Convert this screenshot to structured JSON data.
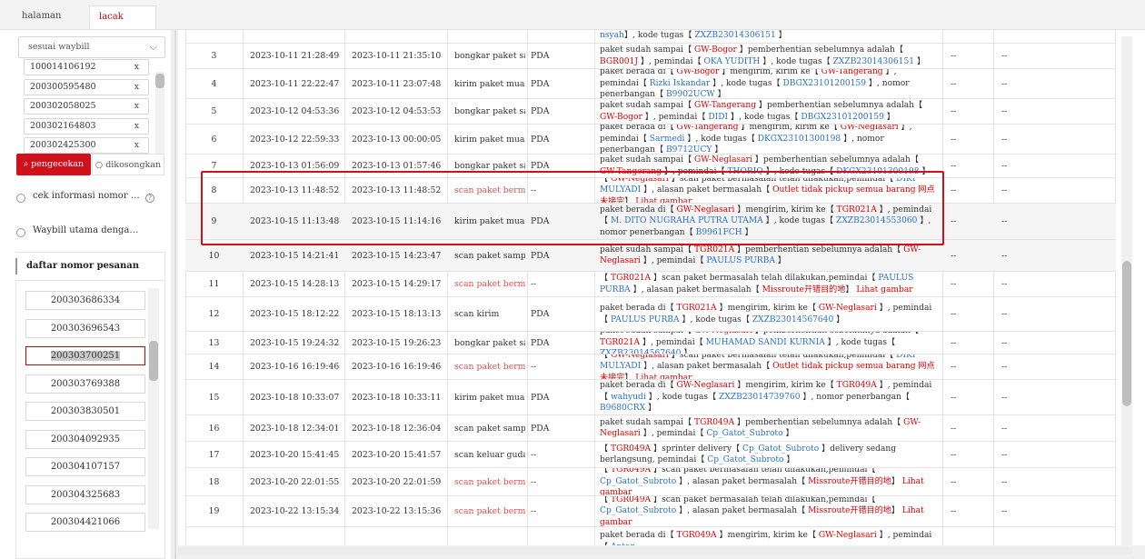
{
  "tabs": [
    {
      "label": "halaman utama",
      "active": false
    },
    {
      "label": "lacak paket",
      "active": true,
      "close": "×"
    }
  ],
  "filter": {
    "select_value": "sesuai waybill",
    "chevron": "chevron-down-icon"
  },
  "waybills": [
    "100014106192",
    "200300595480",
    "200302058025",
    "200302164803",
    "200302425300"
  ],
  "waybill_remove": "x",
  "buttons": {
    "search": "pengecekan",
    "clear": "dikosongkan",
    "search_icon": "search-icon",
    "clear_icon": "circle-icon"
  },
  "options": [
    {
      "label": "cek informasi nomor …",
      "help": "?"
    },
    {
      "label": "Waybill utama denga…"
    }
  ],
  "order_list": {
    "title": "daftar nomor pesanan",
    "items": [
      "200303686334",
      "200303696543",
      "200303700251",
      "200303769388",
      "200303830501",
      "200304092935",
      "200304107157",
      "200304325683",
      "200304421066"
    ],
    "selected_index": 2
  },
  "rows": [
    {
      "no": "",
      "t1": "",
      "t2": "",
      "type": "",
      "type_red": false,
      "src": "",
      "desc": [
        [
          "lk",
          "nsyah"
        ],
        [
          "t",
          "】, kode tugas【 "
        ],
        [
          "lk",
          "ZXZB23014306151"
        ],
        [
          "t",
          " 】"
        ]
      ],
      "a": "",
      "b": ""
    },
    {
      "no": "3",
      "t1": "2023-10-11 21:28:49",
      "t2": "2023-10-11 21:35:10",
      "type": "bongkar paket sampai",
      "type_red": false,
      "src": "PDA",
      "desc": [
        [
          "t",
          "paket sudah sampai【 "
        ],
        [
          "rd",
          "GW-Bogor"
        ],
        [
          "t",
          " 】pemberhentian sebelumnya adalah【 "
        ],
        [
          "rd",
          "BGR001J"
        ],
        [
          "t",
          " 】, pemindai【 "
        ],
        [
          "lk",
          "OKA YUDITH"
        ],
        [
          "t",
          " 】, kode tugas【 "
        ],
        [
          "lk",
          "ZXZB23014306151"
        ],
        [
          "t",
          " 】"
        ]
      ],
      "a": "--",
      "b": "--"
    },
    {
      "no": "4",
      "t1": "2023-10-11 22:22:47",
      "t2": "2023-10-11 23:07:48",
      "type": "kirim paket muatan",
      "type_red": false,
      "src": "PDA",
      "desc": [
        [
          "t",
          "paket berada di【 "
        ],
        [
          "rd",
          "GW-Bogor"
        ],
        [
          "t",
          " 】mengirim, kirim ke【 "
        ],
        [
          "rd",
          "GW-Tangerang"
        ],
        [
          "t",
          " 】, pemindai【 "
        ],
        [
          "lk",
          "Rizki Iskandar"
        ],
        [
          "t",
          " 】, kode tugas【 "
        ],
        [
          "lk",
          "DBGX23101200159"
        ],
        [
          "t",
          " 】, nomor penerbangan【 "
        ],
        [
          "lk",
          "B9902UCW"
        ],
        [
          "t",
          " 】"
        ]
      ],
      "a": "--",
      "b": "--"
    },
    {
      "no": "5",
      "t1": "2023-10-12 04:53:36",
      "t2": "2023-10-12 04:53:53",
      "type": "bongkar paket sampai",
      "type_red": false,
      "src": "PDA",
      "desc": [
        [
          "t",
          "paket sudah sampai【 "
        ],
        [
          "rd",
          "GW-Tangerang"
        ],
        [
          "t",
          " 】pemberhentian sebelumnya adalah【 "
        ],
        [
          "rd",
          "GW-Bogor"
        ],
        [
          "t",
          " 】, pemindai【 "
        ],
        [
          "lk",
          "DIDI"
        ],
        [
          "t",
          " 】, kode tugas【 "
        ],
        [
          "lk",
          "DBGX23101200159"
        ],
        [
          "t",
          " 】"
        ]
      ],
      "a": "--",
      "b": "--"
    },
    {
      "no": "6",
      "t1": "2023-10-12 22:59:33",
      "t2": "2023-10-13 00:00:05",
      "type": "kirim paket muatan",
      "type_red": false,
      "src": "PDA",
      "desc": [
        [
          "t",
          "paket berada di【 "
        ],
        [
          "rd",
          "GW-Tangerang"
        ],
        [
          "t",
          " 】mengirim, kirim ke【 "
        ],
        [
          "rd",
          "GW-Neglasari"
        ],
        [
          "t",
          " 】, pemindai【 "
        ],
        [
          "lk",
          "Sarmedi"
        ],
        [
          "t",
          " 】, kode tugas【 "
        ],
        [
          "lk",
          "DKGX23101300198"
        ],
        [
          "t",
          " 】, nomor penerbangan【 "
        ],
        [
          "lk",
          "B9712UCY"
        ],
        [
          "t",
          " 】"
        ]
      ],
      "a": "--",
      "b": "--"
    },
    {
      "no": "7",
      "t1": "2023-10-13 01:56:09",
      "t2": "2023-10-13 01:57:46",
      "type": "bongkar paket sampai",
      "type_red": false,
      "src": "PDA",
      "desc": [
        [
          "t",
          "paket sudah sampai【 "
        ],
        [
          "rd",
          "GW-Neglasari"
        ],
        [
          "t",
          " 】pemberhentian sebelumnya adalah【 "
        ],
        [
          "rd",
          "GW-Tangerang"
        ],
        [
          "t",
          " 】, pemindai【 "
        ],
        [
          "lk",
          "THORIQ"
        ],
        [
          "t",
          " 】, kode tugas【 "
        ],
        [
          "lk",
          "DKGX23101300198"
        ],
        [
          "t",
          " 】"
        ]
      ],
      "a": "--",
      "b": "--"
    },
    {
      "no": "8",
      "t1": "2023-10-13 11:48:52",
      "t2": "2023-10-13 11:48:52",
      "type": "scan paket bermasalah",
      "type_red": true,
      "src": "--",
      "desc": [
        [
          "t",
          "【 "
        ],
        [
          "rd",
          "GW-Neglasari"
        ],
        [
          "t",
          " 】scan paket bermasalah telah dilakukan,pemindai【 "
        ],
        [
          "lk",
          "DIKI MULYADI"
        ],
        [
          "t",
          " 】, alasan paket bermasalah【 "
        ],
        [
          "rd",
          "Outlet tidak pickup semua barang 网点未接完"
        ],
        [
          "t",
          "】 "
        ],
        [
          "rd",
          "Lihat gambar"
        ]
      ],
      "a": "--",
      "b": "--"
    },
    {
      "no": "9",
      "t1": "2023-10-15 11:13:48",
      "t2": "2023-10-15 11:14:16",
      "type": "kirim paket muatan",
      "type_red": false,
      "src": "PDA",
      "desc": [
        [
          "t",
          "paket berada di【 "
        ],
        [
          "rd",
          "GW-Neglasari"
        ],
        [
          "t",
          " 】mengirim, kirim ke【 "
        ],
        [
          "rd",
          "TGR021A"
        ],
        [
          "t",
          " 】, pemindai【 "
        ],
        [
          "lk",
          "M. DITO NUGRAHA PUTRA UTAMA"
        ],
        [
          "t",
          " 】, kode tugas【 "
        ],
        [
          "lk",
          "ZXZB23014553060"
        ],
        [
          "t",
          " 】, nomor penerbangan【 "
        ],
        [
          "lk",
          "B9961FCH"
        ],
        [
          "t",
          " 】"
        ]
      ],
      "a": "--",
      "b": "--"
    },
    {
      "no": "10",
      "t1": "2023-10-15 14:21:41",
      "t2": "2023-10-15 14:23:47",
      "type": "scan paket sampai",
      "type_red": false,
      "src": "PDA",
      "desc": [
        [
          "t",
          "paket sudah sampai【 "
        ],
        [
          "rd",
          "TGR021A"
        ],
        [
          "t",
          " 】pemberhentian sebelumnya adalah【 "
        ],
        [
          "rd",
          "GW-Neglasari"
        ],
        [
          "t",
          " 】, pemindai【 "
        ],
        [
          "lk",
          "PAULUS PURBA"
        ],
        [
          "t",
          " 】"
        ]
      ],
      "a": "--",
      "b": "--"
    },
    {
      "no": "11",
      "t1": "2023-10-15 14:28:13",
      "t2": "2023-10-15 14:29:17",
      "type": "scan paket bermasalah",
      "type_red": true,
      "src": "--",
      "desc": [
        [
          "t",
          "【 "
        ],
        [
          "rd",
          "TGR021A"
        ],
        [
          "t",
          " 】scan paket bermasalah telah dilakukan,pemindai【 "
        ],
        [
          "lk",
          "PAULUS PURBA"
        ],
        [
          "t",
          " 】, alasan paket bermasalah【 "
        ],
        [
          "rd",
          "Missroute开错目的地"
        ],
        [
          "t",
          "】 "
        ],
        [
          "rd",
          "Lihat gambar"
        ]
      ],
      "a": "--",
      "b": "--"
    },
    {
      "no": "12",
      "t1": "2023-10-15 18:12:22",
      "t2": "2023-10-15 18:13:13",
      "type": "scan kirim",
      "type_red": false,
      "src": "PDA",
      "desc": [
        [
          "t",
          "paket berada di【 "
        ],
        [
          "rd",
          "TGR021A"
        ],
        [
          "t",
          " 】mengirim, kirim ke【 "
        ],
        [
          "rd",
          "GW-Neglasari"
        ],
        [
          "t",
          " 】, pemindai【 "
        ],
        [
          "lk",
          "PAULUS PURBA"
        ],
        [
          "t",
          " 】, kode tugas【 "
        ],
        [
          "lk",
          "ZXZB23014567640"
        ],
        [
          "t",
          " 】"
        ]
      ],
      "a": "--",
      "b": "--"
    },
    {
      "no": "13",
      "t1": "2023-10-15 19:24:32",
      "t2": "2023-10-15 19:26:23",
      "type": "bongkar paket sampai",
      "type_red": false,
      "src": "PDA",
      "desc": [
        [
          "t",
          "paket sudah sampai【 "
        ],
        [
          "rd",
          "GW-Neglasari"
        ],
        [
          "t",
          " 】pemberhentian sebelumnya adalah【 "
        ],
        [
          "rd",
          "TGR021A"
        ],
        [
          "t",
          " 】, pemindai【 "
        ],
        [
          "lk",
          "MUHAMAD SANDI KURNIA"
        ],
        [
          "t",
          " 】, kode tugas【 "
        ],
        [
          "lk",
          "ZXZB23014567640"
        ],
        [
          "t",
          " 】"
        ]
      ],
      "a": "--",
      "b": "--"
    },
    {
      "no": "14",
      "t1": "2023-10-16 16:19:46",
      "t2": "2023-10-16 16:19:46",
      "type": "scan paket bermasalah",
      "type_red": true,
      "src": "--",
      "desc": [
        [
          "t",
          "【 "
        ],
        [
          "rd",
          "GW-Neglasari"
        ],
        [
          "t",
          " 】scan paket bermasalah telah dilakukan,pemindai【 "
        ],
        [
          "lk",
          "DIKI MULYADI"
        ],
        [
          "t",
          " 】, alasan paket bermasalah【 "
        ],
        [
          "rd",
          "Outlet tidak pickup semua barang 网点未接完"
        ],
        [
          "t",
          "】 "
        ],
        [
          "rd",
          "Lihat gambar"
        ]
      ],
      "a": "--",
      "b": "--"
    },
    {
      "no": "15",
      "t1": "2023-10-18 10:33:07",
      "t2": "2023-10-18 10:33:11",
      "type": "kirim paket muatan",
      "type_red": false,
      "src": "PDA",
      "desc": [
        [
          "t",
          "paket berada di【 "
        ],
        [
          "rd",
          "GW-Neglasari"
        ],
        [
          "t",
          " 】mengirim, kirim ke【 "
        ],
        [
          "rd",
          "TGR049A"
        ],
        [
          "t",
          " 】, pemindai【 "
        ],
        [
          "lk",
          "wahyudi"
        ],
        [
          "t",
          " 】, kode tugas【 "
        ],
        [
          "lk",
          "ZXZB23014739760"
        ],
        [
          "t",
          " 】, nomor penerbangan【 "
        ],
        [
          "lk",
          "B9680CRX"
        ],
        [
          "t",
          " 】"
        ]
      ],
      "a": "--",
      "b": "--"
    },
    {
      "no": "16",
      "t1": "2023-10-18 12:34:01",
      "t2": "2023-10-18 12:36:04",
      "type": "scan paket sampai",
      "type_red": false,
      "src": "PDA",
      "desc": [
        [
          "t",
          "paket sudah sampai【 "
        ],
        [
          "rd",
          "TGR049A"
        ],
        [
          "t",
          " 】pemberhentian sebelumnya adalah【 "
        ],
        [
          "rd",
          "GW-Neglasari"
        ],
        [
          "t",
          " 】, pemindai【 "
        ],
        [
          "lk",
          "Cp_Gatot_Subroto"
        ],
        [
          "t",
          " 】"
        ]
      ],
      "a": "--",
      "b": "--"
    },
    {
      "no": "17",
      "t1": "2023-10-20 15:41:45",
      "t2": "2023-10-20 15:41:57",
      "type": "scan keluar gudang",
      "type_red": false,
      "src": "--",
      "desc": [
        [
          "t",
          "【 "
        ],
        [
          "rd",
          "TGR049A"
        ],
        [
          "t",
          " 】sprinter delivery【 "
        ],
        [
          "lk",
          "Cp_Gatot_Subroto"
        ],
        [
          "t",
          " 】delivery sedang berlangsung, pemindai【 "
        ],
        [
          "lk",
          "Cp_Gatot_Subroto"
        ],
        [
          "t",
          " 】"
        ]
      ],
      "a": "--",
      "b": "--"
    },
    {
      "no": "18",
      "t1": "2023-10-20 22:01:55",
      "t2": "2023-10-20 22:01:59",
      "type": "scan paket bermasalah",
      "type_red": true,
      "src": "--",
      "desc": [
        [
          "t",
          "【 "
        ],
        [
          "rd",
          "TGR049A"
        ],
        [
          "t",
          " 】scan paket bermasalah telah dilakukan,pemindai【 "
        ],
        [
          "lk",
          "Cp_Gatot_Subroto"
        ],
        [
          "t",
          " 】, alasan paket bermasalah【 "
        ],
        [
          "rd",
          "Missroute开错目的地"
        ],
        [
          "t",
          "】 "
        ],
        [
          "rd",
          "Lihat gambar"
        ]
      ],
      "a": "--",
      "b": "--"
    },
    {
      "no": "19",
      "t1": "2023-10-22 13:15:34",
      "t2": "2023-10-22 13:15:36",
      "type": "scan paket bermasalah",
      "type_red": true,
      "src": "--",
      "desc": [
        [
          "t",
          "【 "
        ],
        [
          "rd",
          "TGR049A"
        ],
        [
          "t",
          " 】scan paket bermasalah telah dilakukan,pemindai【 "
        ],
        [
          "lk",
          "Cp_Gatot_Subroto"
        ],
        [
          "t",
          " 】, alasan paket bermasalah【 "
        ],
        [
          "rd",
          "Missroute开错目的地"
        ],
        [
          "t",
          "】 "
        ],
        [
          "rd",
          "Lihat gambar"
        ]
      ],
      "a": "--",
      "b": "--"
    },
    {
      "no": "",
      "t1": "",
      "t2": "",
      "type": "",
      "type_red": false,
      "src": "",
      "desc": [
        [
          "t",
          "paket berada di【 "
        ],
        [
          "rd",
          "TGR049A"
        ],
        [
          "t",
          " 】mengirim, kirim ke【 "
        ],
        [
          "rd",
          "GW-Neglasari"
        ],
        [
          "t",
          " 】, pemindai【 "
        ],
        [
          "lk",
          "Antar"
        ]
      ],
      "a": "",
      "b": ""
    }
  ]
}
